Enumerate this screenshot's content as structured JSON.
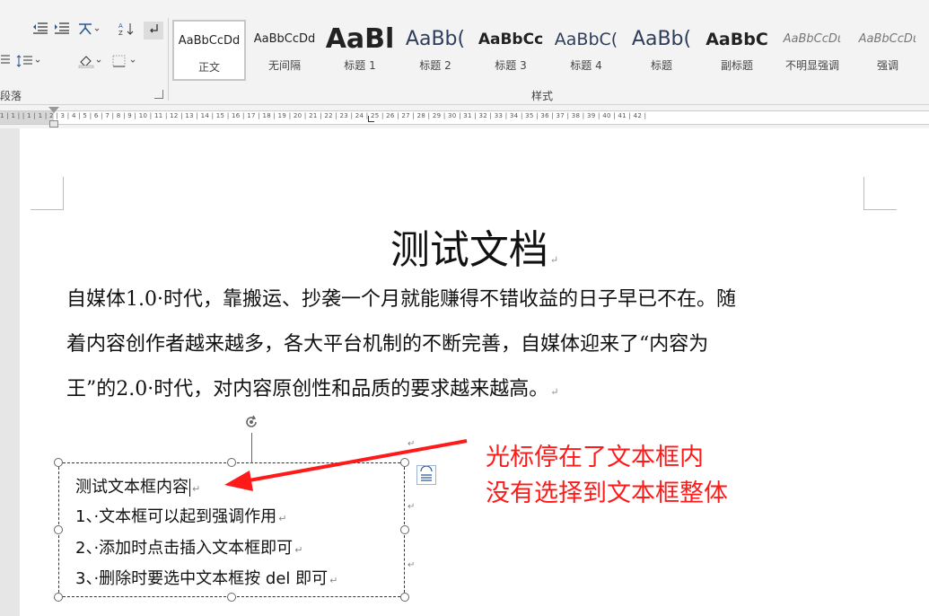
{
  "ribbon": {
    "paragraph_group_label": "段落",
    "styles_group_label": "样式",
    "styles": [
      {
        "preview": "AaBbCcDd",
        "name": "正文",
        "selected": true,
        "size": 13,
        "weight": "normal",
        "italic": false
      },
      {
        "preview": "AaBbCcDd",
        "name": "无间隔",
        "selected": false,
        "size": 13,
        "weight": "normal",
        "italic": false
      },
      {
        "preview": "AaBl",
        "name": "标题 1",
        "selected": false,
        "size": 30,
        "weight": "bold",
        "italic": false
      },
      {
        "preview": "AaBb(",
        "name": "标题 2",
        "selected": false,
        "size": 22,
        "weight": "normal",
        "italic": false
      },
      {
        "preview": "AaBbCc",
        "name": "标题 3",
        "selected": false,
        "size": 17,
        "weight": "bold",
        "italic": false
      },
      {
        "preview": "AaBbC(",
        "name": "标题 4",
        "selected": false,
        "size": 19,
        "weight": "normal",
        "italic": false
      },
      {
        "preview": "AaBb(",
        "name": "标题",
        "selected": false,
        "size": 22,
        "weight": "normal",
        "italic": false
      },
      {
        "preview": "AaBbC",
        "name": "副标题",
        "selected": false,
        "size": 19,
        "weight": "bold",
        "italic": false
      },
      {
        "preview": "AaBbCcDι",
        "name": "不明显强调",
        "selected": false,
        "size": 13,
        "weight": "normal",
        "italic": true
      },
      {
        "preview": "AaBbCcDι",
        "name": "强调",
        "selected": false,
        "size": 13,
        "weight": "normal",
        "italic": true
      }
    ]
  },
  "ruler": {
    "text": "1 | 1 |    | 1 | 1 | 2 | 3 | 4 | 5 | 6 | 7 | 8 | 9 | 10 | 11 | 12 | 13 | 14 | 15 | 16 | 17 | 18 | 19 | 20 | 21 | 22 | 23 | 24 | 25 | 26 | 27 | 28 | 29 | 30 | 31 | 32 | 33 | 34 | 35 | 36 | 37 | 38 | 39 | 40 | 41 | 42 |"
  },
  "document": {
    "title": "测试文档",
    "paragraph_lines": [
      "自媒体1.0·时代，靠搬运、抄袭一个月就能赚得不错收益的日子早已不在。随",
      "着内容创作者越来越多，各大平台机制的不断完善，自媒体迎来了“内容为",
      "王”的2.0·时代，对内容原创性和品质的要求越来越高。"
    ],
    "paragraph_mark": "↵"
  },
  "textbox": {
    "lines": [
      "测试文本框内容",
      "1、·文本框可以起到强调作用",
      "2、·添加时点击插入文本框即可",
      "3、·删除时要选中文本框按 del 即可"
    ]
  },
  "annotation": {
    "lines": [
      "光标停在了文本框内",
      "没有选择到文本框整体"
    ],
    "color": "#ff1a1a"
  }
}
